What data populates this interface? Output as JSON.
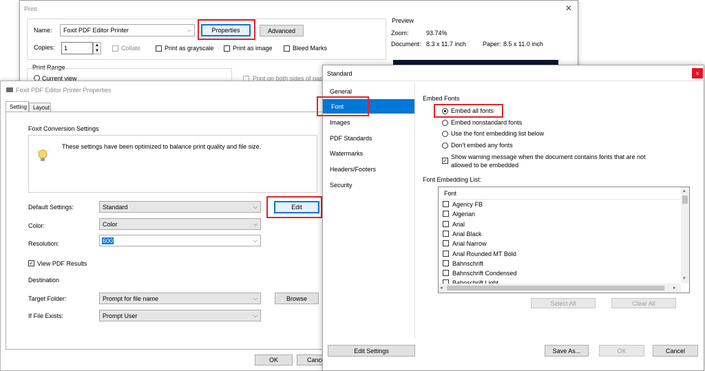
{
  "print": {
    "title": "Print",
    "name_label": "Name:",
    "printer": "Foxit PDF Editor Printer",
    "properties_label": "Properties",
    "advanced_label": "Advanced",
    "copies_label": "Copies:",
    "copies_value": "1",
    "collate_label": "Collate",
    "grayscale_label": "Print as grayscale",
    "as_image_label": "Print as image",
    "bleed_label": "Bleed Marks",
    "print_range_label": "Print Range",
    "current_view_label": "Current view",
    "both_sides_label": "Print on both sides of pap",
    "preview_label": "Preview",
    "zoom_label": "Zoom:",
    "zoom_value": "93.74%",
    "document_label": "Document:",
    "document_value": "8.3 x 11.7 inch",
    "paper_label": "Paper:",
    "paper_value": "8.5 x 11.0 inch"
  },
  "props": {
    "title": "Foxit PDF Editor Printer Properties",
    "tab_setting": "Setting",
    "tab_layout": "Layout",
    "conversion_label": "Foxit Conversion Settings",
    "info_text": "These settings have been optimized to balance print quality and file size.",
    "default_settings_label": "Default Settings:",
    "default_settings_value": "Standard",
    "edit_label": "Edit",
    "color_label": "Color:",
    "color_value": "Color",
    "resolution_label": "Resolution:",
    "resolution_value": "600",
    "view_pdf_label": "View PDF Results",
    "destination_label": "Destination",
    "target_folder_label": "Target Folder:",
    "target_folder_value": "Prompt for file name",
    "browse_label": "Browse",
    "if_exists_label": "If File Exists:",
    "if_exists_value": "Prompt User",
    "ok_label": "OK",
    "cancel_label": "Cancel"
  },
  "standard": {
    "title": "Standard",
    "close_label": "x",
    "nav": [
      "General",
      "Font",
      "Images",
      "PDF Standards",
      "Watermarks",
      "Headers/Footers",
      "Security"
    ],
    "embed_fonts_label": "Embed Fonts",
    "options": [
      "Embed all fonts",
      "Embed nonstandard fonts",
      "Use the font embedding list below",
      "Don't embed any fonts"
    ],
    "warning_label_1": "Show warning message when the document contains fonts that are not",
    "warning_label_2": "allowed to be embedded",
    "list_label": "Font Embedding List:",
    "list_header": "Font",
    "fonts": [
      "Agency FB",
      "Algerian",
      "Arial",
      "Arial Black",
      "Arial Narrow",
      "Arial Rounded MT Bold",
      "Bahnschrift",
      "Bahnschrift Condensed",
      "Bahnschrift Light"
    ],
    "select_all_label": "Select All",
    "clear_all_label": "Clear All",
    "edit_settings_label": "Edit Settings",
    "save_as_label": "Save As...",
    "ok_label": "OK",
    "cancel_label": "Cancel"
  },
  "colors": {
    "accent": "#0078d7",
    "highlight": "#e02424",
    "close_red": "#e81123"
  }
}
